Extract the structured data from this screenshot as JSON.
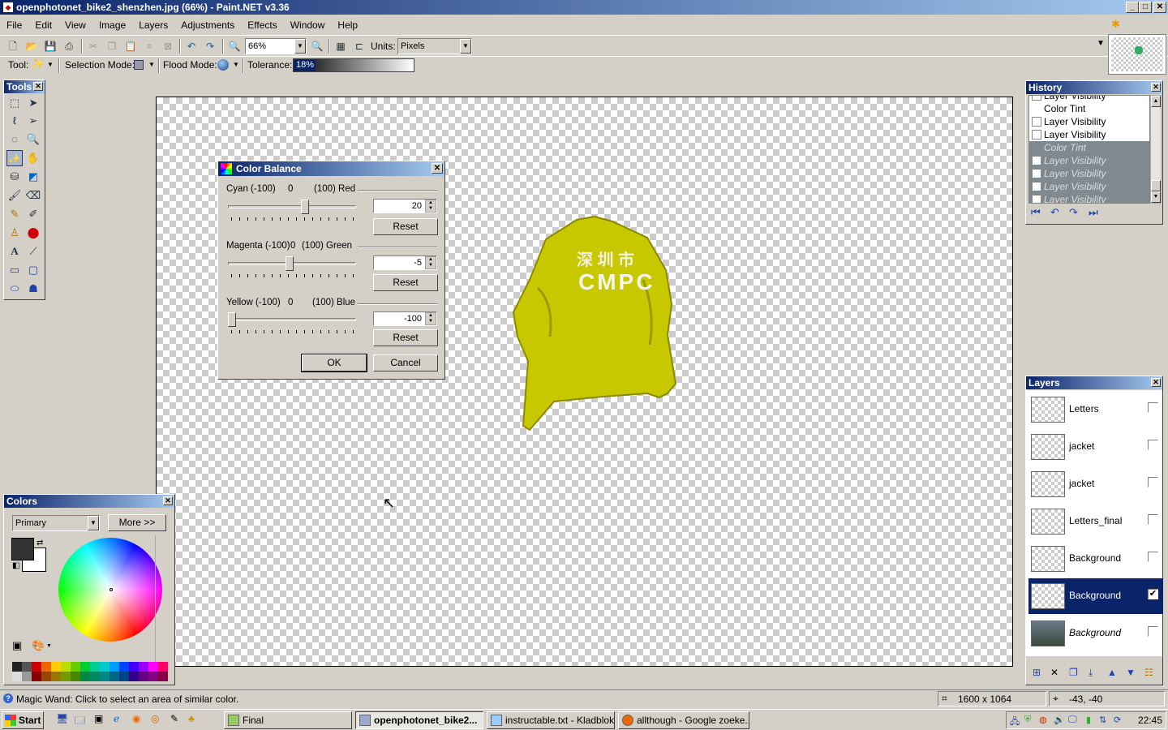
{
  "window": {
    "title": "openphotonet_bike2_shenzhen.jpg (66%) - Paint.NET v3.36"
  },
  "menu": [
    "File",
    "Edit",
    "View",
    "Image",
    "Layers",
    "Adjustments",
    "Effects",
    "Window",
    "Help"
  ],
  "toolbar": {
    "zoom_value": "66%",
    "units_label": "Units:",
    "units_value": "Pixels"
  },
  "tool_options": {
    "tool_label": "Tool:",
    "selection_mode_label": "Selection Mode:",
    "flood_mode_label": "Flood Mode:",
    "tolerance_label": "Tolerance:",
    "tolerance_value": "18%",
    "tolerance_fraction": 0.18
  },
  "tools_panel": {
    "title": "Tools"
  },
  "dialog": {
    "title": "Color Balance",
    "sliders": [
      {
        "left": "Cyan (-100)",
        "zero": "0",
        "right": "(100) Red",
        "value": "20",
        "fraction": 0.6,
        "reset": "Reset"
      },
      {
        "left": "Magenta (-100)",
        "zero": "0",
        "right": "(100) Green",
        "value": "-5",
        "fraction": 0.475,
        "reset": "Reset"
      },
      {
        "left": "Yellow (-100)",
        "zero": "0",
        "right": "(100) Blue",
        "value": "-100",
        "fraction": 0.0,
        "reset": "Reset"
      }
    ],
    "ok": "OK",
    "cancel": "Cancel"
  },
  "canvas_text": {
    "jacket_letters": "CMPC"
  },
  "colors_panel": {
    "title": "Colors",
    "mode": "Primary",
    "more_button": "More >>",
    "primary_color": "#333333",
    "secondary_color": "#ffffff"
  },
  "history_panel": {
    "title": "History",
    "items": [
      {
        "label": "Layer Visibility",
        "undone": false
      },
      {
        "label": "Color Tint",
        "undone": false
      },
      {
        "label": "Layer Visibility",
        "undone": false
      },
      {
        "label": "Layer Visibility",
        "undone": false
      },
      {
        "label": "Color Tint",
        "undone": true
      },
      {
        "label": "Layer Visibility",
        "undone": true
      },
      {
        "label": "Layer Visibility",
        "undone": true
      },
      {
        "label": "Layer Visibility",
        "undone": true
      },
      {
        "label": "Layer Visibility",
        "undone": true
      }
    ]
  },
  "layers_panel": {
    "title": "Layers",
    "layers": [
      {
        "name": "Letters",
        "visible": false,
        "selected": false
      },
      {
        "name": "jacket",
        "visible": false,
        "selected": false
      },
      {
        "name": "jacket",
        "visible": false,
        "selected": false
      },
      {
        "name": "Letters_final",
        "visible": false,
        "selected": false
      },
      {
        "name": "Background",
        "visible": false,
        "selected": false
      },
      {
        "name": "Background",
        "visible": true,
        "selected": true
      },
      {
        "name": "Background",
        "visible": false,
        "selected": false
      }
    ]
  },
  "status": {
    "message": "Magic Wand: Click to select an area of similar color.",
    "image_size": "1600 x 1064",
    "cursor_pos": "-43, -40"
  },
  "taskbar": {
    "start": "Start",
    "tasks": [
      "Final",
      "openphotonet_bike2...",
      "instructable.txt - Kladblok",
      "allthough - Google zoeke..."
    ],
    "clock": "22:45"
  }
}
